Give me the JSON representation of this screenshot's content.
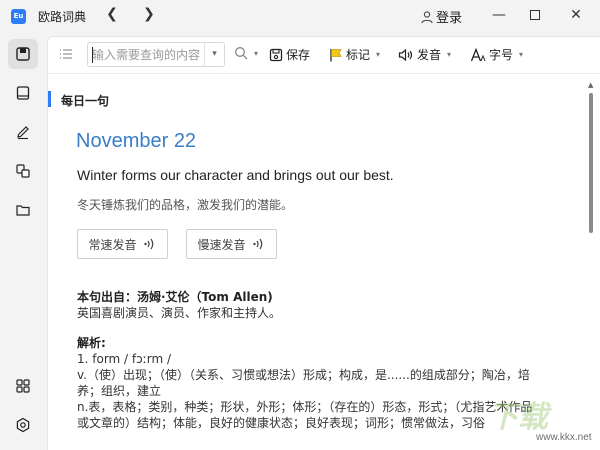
{
  "titlebar": {
    "app_title": "欧路词典",
    "logo_text": "Eu",
    "login_label": "登录"
  },
  "toolbar": {
    "search_placeholder": "输入需要查询的内容",
    "save_label": "保存",
    "mark_label": "标记",
    "speak_label": "发音",
    "font_label": "字号"
  },
  "content": {
    "section_title": "每日一句",
    "date": "November 22",
    "sentence_en": "Winter forms our character and brings out our best.",
    "sentence_cn": "冬天锤炼我们的品格，激发我们的潜能。",
    "speak_normal_label": "常速发音",
    "speak_slow_label": "慢速发音",
    "source_label": "本句出自：汤姆·艾伦（Tom Allen)",
    "source_desc": "英国喜剧演员、演员、作家和主持人。",
    "analysis_label": "解析:",
    "analysis_line1": "1. form / fɔːrm /",
    "analysis_line2": "v.（使）出现；（使）（关系、习惯或想法）形成；构成，是......的组成部分；陶冶，培",
    "analysis_line3": "养；组织，建立",
    "analysis_line4": "n.表，表格；类别，种类；形状，外形；体形；（存在的）形态，形式；（尤指艺术作品",
    "analysis_line5": "或文章的）结构；体能，良好的健康状态；良好表现；词形；惯常做法，习俗"
  },
  "watermark": {
    "text": "下载",
    "url": "www.kkx.net"
  },
  "colors": {
    "accent": "#2f7df6",
    "date_blue": "#3a7ec8"
  }
}
